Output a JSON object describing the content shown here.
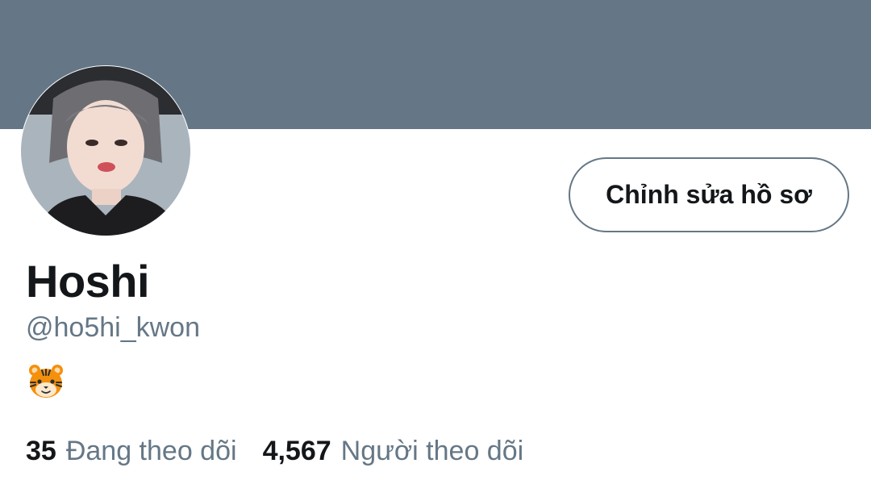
{
  "profile": {
    "display_name": "Hoshi",
    "handle": "@ho5hi_kwon",
    "bio_icon": "tiger-face-emoji",
    "edit_button_label": "Chỉnh sửa hồ sơ",
    "following_count": "35",
    "following_label": "Đang theo dõi",
    "followers_count": "4,567",
    "followers_label": "Người theo dõi"
  },
  "colors": {
    "banner": "#657786",
    "primary_text": "#14171a",
    "secondary_text": "#657786",
    "background": "#ffffff"
  }
}
